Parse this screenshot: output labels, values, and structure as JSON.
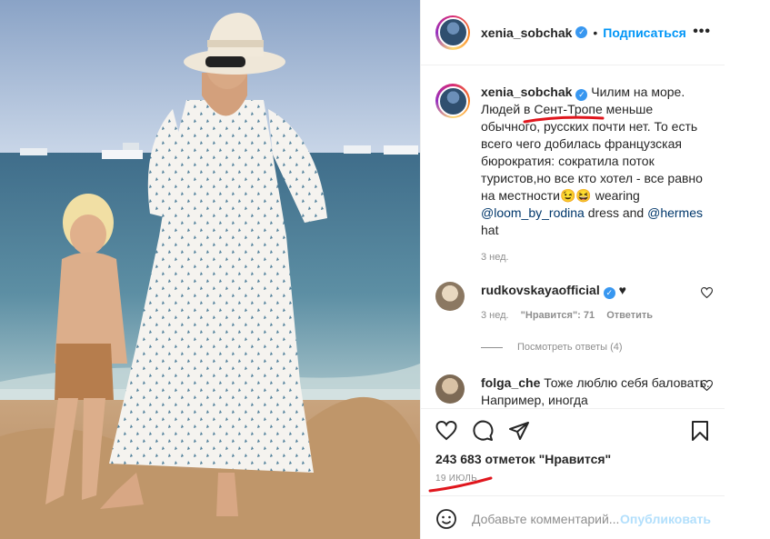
{
  "post": {
    "username": "xenia_sobchak",
    "dot": "•",
    "follow_label": "Подписаться",
    "more": "•••",
    "caption_username": "xenia_sobchak",
    "caption_text_1": "Чилим на море. Людей ",
    "caption_text_hl": "в Сент-Тропе",
    "caption_text_2": " меньше обычного, русских почти нет. То есть всего чего добилась французская бюрократия: сократила поток туристов,но все кто хотел - все равно на местности😉😆 wearing ",
    "caption_mention_1": "@loom_by_rodina",
    "caption_text_3": " dress and ",
    "caption_mention_2": "@hermes",
    "caption_text_4": " hat",
    "caption_time": "3 нед."
  },
  "comments": [
    {
      "username": "rudkovskayaofficial",
      "text": "♥",
      "time": "3 нед.",
      "likes": "\"Нравится\": 71",
      "reply": "Ответить"
    },
    {
      "username": "folga_che",
      "text": "Тоже люблю себя баловать. Например, иногда"
    }
  ],
  "view_replies": "Посмотреть ответы (4)",
  "likes_text": "243 683 отметок \"Нравится\"",
  "date_text": "19 ИЮЛЬ",
  "add_comment_placeholder": "Добавьте комментарий...",
  "publish_label": "Опубликовать",
  "colors": {
    "accent": "#0095f6",
    "verified": "#3897f0",
    "annotation": "#e0161d"
  }
}
